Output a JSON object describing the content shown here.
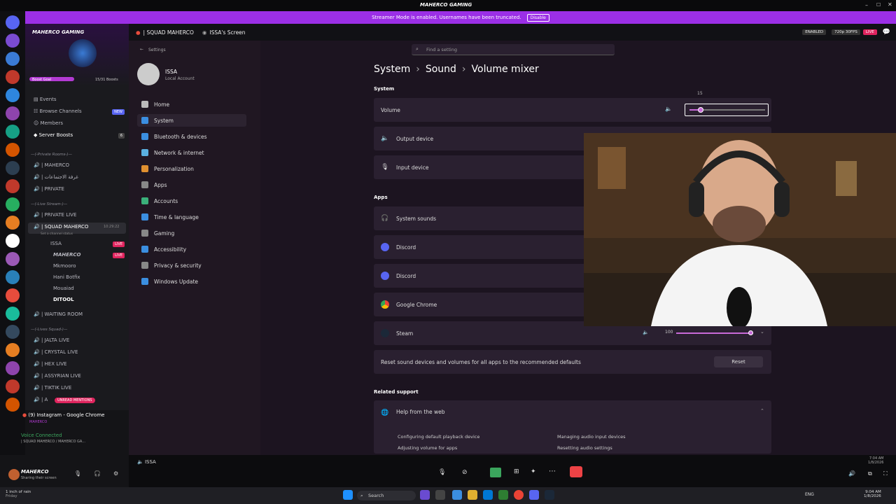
{
  "window_title": "MAHERCO GAMING",
  "banner": {
    "text": "Streamer Mode is enabled. Usernames have been truncated.",
    "button": "Disable"
  },
  "server": {
    "name": "MAHERCO GAMING",
    "boost_goal": "Boost Goal",
    "boosts": "15/31 Boosts"
  },
  "channel_menu": [
    "Events",
    "Browse Channels",
    "Members",
    "Server Boosts"
  ],
  "channel_badges": {
    "new": "NEW",
    "boosts_count": "6"
  },
  "sections": [
    "—(-Private Rooms-)—",
    "—(-Live Stream-)—",
    "—(-Lives Squad-)—"
  ],
  "channels_a": [
    "| MAHERCO",
    "| غرفة الاجتماعات",
    "| PRIVATE"
  ],
  "channels_b": [
    "| PRIVATE LIVE",
    "| SQUAD MAHERCO"
  ],
  "channel_status": "Set a channel status",
  "channel_time": "10:29:22",
  "members": [
    "ISSA",
    "MAHERCO",
    "Mkmooro",
    "Hani Botfix",
    "Mouaiad",
    "DITOOL"
  ],
  "live_label": "LIVE",
  "channels_c": [
    "| WAITING ROOM"
  ],
  "channels_d": [
    "| JALTA LIVE",
    "| CRYSTAL LIVE",
    "| HEX LIVE",
    "| ASSYRIAN LIVE",
    "| TIKTIK LIVE",
    "| A"
  ],
  "unread_mentions": "UNREAD MENTIONS",
  "activity": {
    "title": "(9) Instagram - Google Chrome",
    "subtitle": "MAHERCO"
  },
  "voice": {
    "status": "Voice Connected",
    "channel": "| SQUAD MAHERCO / MAHERCO GA..."
  },
  "user": {
    "name": "MAHERCO",
    "status": "Sharing their screen"
  },
  "stream_header": {
    "channel": "| SQUAD MAHERCO",
    "screen": "ISSA's Screen",
    "enabled": "ENABLED",
    "quality": "720p 30FPS",
    "live": "LIVE"
  },
  "settings": {
    "label": "Settings",
    "search_placeholder": "Find a setting",
    "account_name": "ISSA",
    "account_type": "Local Account",
    "nav": [
      "Home",
      "System",
      "Bluetooth & devices",
      "Network & internet",
      "Personalization",
      "Apps",
      "Accounts",
      "Time & language",
      "Gaming",
      "Accessibility",
      "Privacy & security",
      "Windows Update"
    ],
    "breadcrumb": [
      "System",
      "Sound",
      "Volume mixer"
    ],
    "system_header": "System",
    "volume_label": "Volume",
    "volume_value": "15",
    "volume_fraction": 0.15,
    "output_device": "Output device",
    "input_device": "Input device",
    "apps_header": "Apps",
    "apps": [
      "System sounds",
      "Discord",
      "Discord",
      "Google Chrome",
      "Steam"
    ],
    "steam_volume": "100",
    "reset_text": "Reset sound devices and volumes for all apps to the recommended defaults",
    "reset_button": "Reset",
    "related_header": "Related support",
    "help_title": "Help from the web",
    "help_links": [
      "Configuring default playback device",
      "Managing audio input devices",
      "Adjusting volume for apps",
      "Resetting audio settings"
    ]
  },
  "stream_footer": {
    "user": "ISSA"
  },
  "taskbar": {
    "weather": "1 inch of rain",
    "weather_sub": "Friday",
    "search": "Search",
    "time": "9:04 AM",
    "date": "1/8/2026",
    "stream_time": "7:04 AM",
    "stream_date": "1/8/2026",
    "lang": "ENG"
  },
  "colors": {
    "accent": "#9b2fe6",
    "live_red": "#e0245e",
    "slider": "#c86ad8"
  }
}
